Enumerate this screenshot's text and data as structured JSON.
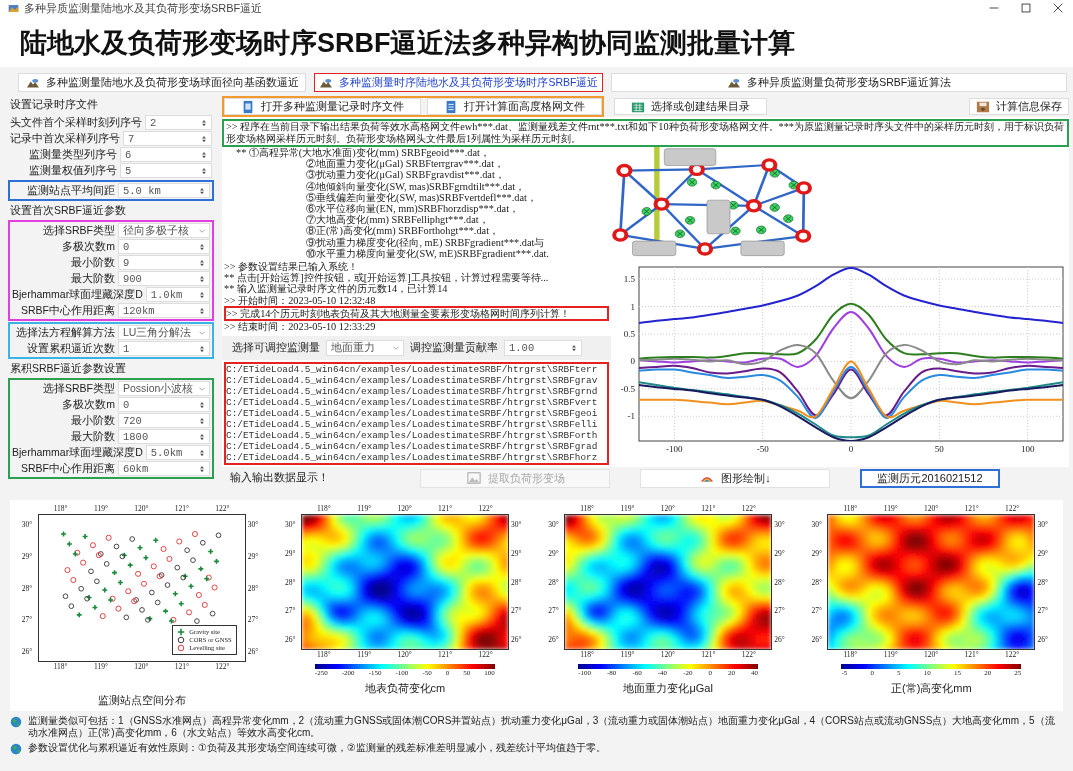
{
  "window": {
    "title": "多种异质监测量陆地水及其负荷形变场SRBF逼近"
  },
  "heading": "陆地水及负荷形变场时序SRBF逼近法多种异构协同监测批量计算",
  "tabs": [
    {
      "label": "多种监测量陆地水及负荷形变场球面径向基函数逼近",
      "selected": false
    },
    {
      "label": "多种监测量时序陆地水及其负荷形变场时序SRBF逼近",
      "selected": true
    },
    {
      "label": "多种异质监测量负荷形变场SRBF逼近算法",
      "selected": false
    }
  ],
  "settings": [
    {
      "kind": "header",
      "text": "设置记录时序文件"
    },
    {
      "kind": "group",
      "rows": [
        {
          "kind": "spin",
          "label": "头文件首个采样时刻列序号",
          "value": "2"
        },
        {
          "kind": "spin",
          "label": "记录中首次采样列序号",
          "value": "7"
        },
        {
          "kind": "spin",
          "label": "监测量类型列序号",
          "value": "6"
        },
        {
          "kind": "spin",
          "label": "监测量权值列序号",
          "value": "5"
        }
      ]
    },
    {
      "kind": "group",
      "color": "#2f6fd8",
      "rows": [
        {
          "kind": "spin",
          "label": "监测站点平均间距",
          "value": "5.0 km"
        }
      ]
    },
    {
      "kind": "header",
      "text": "设置首次SRBF逼近参数"
    },
    {
      "kind": "group",
      "color": "#e23ee0",
      "rows": [
        {
          "kind": "combo",
          "label": "选择SRBF类型",
          "value": "径向多极子核"
        },
        {
          "kind": "spin",
          "label": "多极次数m",
          "value": "0"
        },
        {
          "kind": "spin",
          "label": "最小阶数",
          "value": "9"
        },
        {
          "kind": "spin",
          "label": "最大阶数",
          "value": "900"
        },
        {
          "kind": "spin",
          "label": "Bjerhammar球面埋藏深度D",
          "value": "1.0km"
        },
        {
          "kind": "spin",
          "label": "SRBF中心作用距离",
          "value": "120km"
        }
      ]
    },
    {
      "kind": "group",
      "color": "#38b4e6",
      "rows": [
        {
          "kind": "combo",
          "label": "选择法方程解算方法",
          "value": "LU三角分解法"
        },
        {
          "kind": "spin",
          "label": "设置累积逼近次数",
          "value": "1"
        }
      ]
    },
    {
      "kind": "header",
      "text": "累积SRBF逼近参数设置"
    },
    {
      "kind": "group",
      "color": "#2aa050",
      "rows": [
        {
          "kind": "combo",
          "label": "选择SRBF类型",
          "value": "Possion小波核"
        },
        {
          "kind": "spin",
          "label": "多极次数m",
          "value": "0"
        },
        {
          "kind": "spin",
          "label": "最小阶数",
          "value": "720"
        },
        {
          "kind": "spin",
          "label": "最大阶数",
          "value": "1800"
        },
        {
          "kind": "spin",
          "label": "Bjerhammar球面埋藏深度D",
          "value": "5.0km"
        },
        {
          "kind": "spin",
          "label": "SRBF中心作用距离",
          "value": "60km"
        }
      ]
    }
  ],
  "toolbar": {
    "highlight": {
      "color": "#f29a2e",
      "buttons": [
        {
          "label": "打开多种监测量记录时序文件"
        },
        {
          "label": "打开计算面高度格网文件"
        }
      ]
    },
    "buttons": [
      {
        "label": "选择或创建结果目录"
      },
      {
        "label": "计算信息保存"
      }
    ]
  },
  "log": {
    "summary": {
      "color": "#2aa050",
      "text": ">> 程序在当前目录下输出结果负荷等效水高格网文件ewh***.dat、监测量残差文件rnt***.txt和如下10种负荷形变场格网文件。***为原监测量记录时序头文件中的采样历元时刻，用于标识负荷形变场格网采样历元时刻。负荷形变场格网头文件最后1列属性为采样历元时刻。"
    },
    "lines": [
      "**  ①高程异常(大地水准面)变化(mm) SRBFgeoid***.dat，",
      "②地面重力变化(μGal) SRBFterrgrav***.dat，",
      "③扰动重力变化(μGal) SRBFgravdist***.dat，",
      "④地倾斜向量变化(SW, mas)SRBFgrndtilt***.dat，",
      "⑤垂线偏差向量变化(SW, mas)SRBFvertdefl***.dat，",
      "⑥水平位移向量(EN, mm)SRBFhorzdisp***.dat，",
      "⑦大地高变化(mm) SRBFelliphgt***.dat，",
      "⑧正(常)高变化(mm) SRBForthohgt***.dat，",
      "⑨扰动重力梯度变化(径向, mE) SRBFgradient***.dat与",
      "⑩水平重力梯度向量变化(SW, mE)SRBFgradient***.dat."
    ]
  },
  "status": [
    {
      "text": ">> 参数设置结果已输入系统！"
    },
    {
      "text": "** 点击[开始运算]控件按钮，或[开始运算]工具按钮，计算过程需要等待..."
    },
    {
      "text": "** 输入监测量记录时序文件的历元数14，已计算14"
    },
    {
      "text": ">> 开始时间：2023-05-10 12:32:48"
    },
    {
      "text": ">> 完成14个历元时刻地表负荷及其大地测量全要素形变场格网时间序列计算！",
      "color": "#e52222"
    },
    {
      "text": ">> 结束时间：2023-05-10 12:33:29"
    }
  ],
  "adjust": {
    "label": "选择可调控监测量",
    "quantity": "地面重力",
    "ratio_label": "调控监测量贡献率",
    "ratio": "1.00"
  },
  "files": {
    "color": "#e52222",
    "lines": [
      "C:/ETideLoad4.5_win64cn/examples/LoadestimateSRBF/htrgrst\\SRBFterr",
      "C:/ETideLoad4.5_win64cn/examples/LoadestimateSRBF/htrgrst\\SRBFgrav",
      "C:/ETideLoad4.5_win64cn/examples/LoadestimateSRBF/htrgrst\\SRBFgrnd",
      "C:/ETideLoad4.5_win64cn/examples/LoadestimateSRBF/htrgrst\\SRBFvert",
      "C:/ETideLoad4.5_win64cn/examples/LoadestimateSRBF/htrgrst\\SRBFgeoi",
      "C:/ETideLoad4.5_win64cn/examples/LoadestimateSRBF/htrgrst\\SRBFelli",
      "C:/ETideLoad4.5_win64cn/examples/LoadestimateSRBF/htrgrst\\SRBForth",
      "C:/ETideLoad4.5_win64cn/examples/LoadestimateSRBF/htrgrst\\SRBFgrad",
      "C:/ETideLoad4.5_win64cn/examples/LoadestimateSRBF/htrgrst\\SRBFhorz"
    ]
  },
  "plot": {
    "chart_data": {
      "type": "line",
      "grid": true,
      "x": [
        -120,
        -110,
        -100,
        -90,
        -80,
        -70,
        -60,
        -50,
        -40,
        -30,
        -20,
        -10,
        0,
        10,
        20,
        30,
        40,
        50,
        60,
        70,
        80,
        90,
        100,
        110,
        120
      ],
      "xlim": [
        -120,
        120
      ],
      "ylim": [
        -1.45,
        1.72
      ],
      "xticks": [
        -100,
        -50,
        0,
        50,
        100
      ],
      "yticks": [
        -1,
        -0.5,
        0,
        0.5,
        1,
        1.5
      ],
      "series": [
        {
          "color": "#2323d0",
          "values": [
            0.7,
            0.74,
            0.77,
            0.8,
            0.85,
            0.9,
            0.96,
            1.02,
            1.1,
            1.2,
            1.37,
            1.58,
            1.7,
            1.58,
            1.37,
            1.2,
            1.1,
            1.02,
            0.96,
            0.9,
            0.85,
            0.8,
            0.77,
            0.74,
            0.7
          ]
        },
        {
          "color": "#2e7d1e",
          "values": [
            0.05,
            0.07,
            0.08,
            0.08,
            0.07,
            0.1,
            0.15,
            0.15,
            0.13,
            0.15,
            0.4,
            0.85,
            1.05,
            0.85,
            0.4,
            0.15,
            0.13,
            0.15,
            0.15,
            0.1,
            0.07,
            0.08,
            0.08,
            0.07,
            0.05
          ]
        },
        {
          "color": "#a040e0",
          "values": [
            0.02,
            0,
            -0.02,
            0,
            0.02,
            0,
            -0.02,
            0.05,
            0.05,
            -0.1,
            0.1,
            0.6,
            0.9,
            0.6,
            0.1,
            -0.1,
            0.05,
            0.05,
            -0.02,
            0,
            0.02,
            0,
            -0.02,
            0,
            0.02
          ]
        },
        {
          "color": "#8a8a8a",
          "values": [
            0.02,
            0.03,
            0.05,
            0.03,
            0,
            0.02,
            -0.05,
            0,
            0.2,
            0.3,
            0.15,
            -0.35,
            -0.67,
            -0.35,
            0.15,
            0.3,
            0.2,
            0,
            -0.05,
            0.02,
            0,
            0.03,
            0.05,
            0.03,
            0.02
          ]
        },
        {
          "color": "#6a1b8a",
          "values": [
            -0.12,
            -0.1,
            -0.08,
            -0.12,
            -0.2,
            -0.22,
            -0.18,
            -0.13,
            -0.2,
            -0.55,
            -0.98,
            -0.6,
            -0.15,
            -0.6,
            -0.98,
            -0.55,
            -0.2,
            -0.13,
            -0.18,
            -0.22,
            -0.2,
            -0.12,
            -0.08,
            -0.1,
            -0.12
          ]
        },
        {
          "color": "#2a8ae0",
          "values": [
            -0.17,
            -0.15,
            -0.15,
            -0.2,
            -0.25,
            -0.3,
            -0.28,
            -0.25,
            -0.35,
            -0.65,
            -1.03,
            -0.55,
            -0.1,
            -0.55,
            -1.03,
            -0.65,
            -0.35,
            -0.25,
            -0.28,
            -0.3,
            -0.25,
            -0.2,
            -0.15,
            -0.15,
            -0.17
          ]
        },
        {
          "color": "#f0901e",
          "values": [
            -0.7,
            -0.7,
            -0.7,
            -0.72,
            -0.75,
            -0.78,
            -0.75,
            -0.72,
            -0.8,
            -0.9,
            -1,
            -0.5,
            0,
            -0.5,
            -1,
            -0.9,
            -0.8,
            -0.72,
            -0.75,
            -0.78,
            -0.75,
            -0.72,
            -0.7,
            -0.7,
            -0.7
          ]
        },
        {
          "color": "#1e8a8a",
          "values": [
            -0.38,
            -0.43,
            -0.48,
            -0.52,
            -0.56,
            -0.6,
            -0.65,
            -0.7,
            -0.8,
            -0.95,
            -1.15,
            -1.35,
            -1.38,
            -1.35,
            -1.15,
            -0.95,
            -0.8,
            -0.7,
            -0.65,
            -0.6,
            -0.56,
            -0.52,
            -0.48,
            -0.43,
            -0.38
          ]
        },
        {
          "color": "#1a1a60",
          "values": [
            -0.43,
            -0.47,
            -0.5,
            -0.53,
            -0.58,
            -0.62,
            -0.66,
            -0.7,
            -0.82,
            -1,
            -1.2,
            -1.38,
            -1.45,
            -1.38,
            -1.2,
            -1,
            -0.82,
            -0.7,
            -0.66,
            -0.62,
            -0.58,
            -0.53,
            -0.5,
            -0.47,
            -0.43
          ]
        }
      ]
    }
  },
  "actions": [
    {
      "kind": "label",
      "text": "输入输出数据显示！"
    },
    {
      "kind": "button",
      "label": "提取负荷形变场",
      "disabled": true
    },
    {
      "kind": "button",
      "label": "图形绘制↓",
      "disabled": false
    },
    {
      "kind": "button",
      "label": "监测历元2016021512",
      "disabled": false,
      "color": "#2f6fd8"
    }
  ],
  "maps": [
    {
      "kind": "stations",
      "caption": "监测站点空间分布",
      "axes": {
        "top": [
          "118°",
          "119°",
          "120°",
          "121°",
          "122°"
        ],
        "bottom": [
          "118°",
          "119°",
          "120°",
          "121°",
          "122°"
        ],
        "left": [
          "30°",
          "29°",
          "28°",
          "27°",
          "26°"
        ],
        "right": [
          "30°",
          "29°",
          "28°",
          "27°",
          "26°"
        ]
      },
      "legend": [
        "Gravity site",
        "CORS or GNSS",
        "Levelling site"
      ]
    },
    {
      "kind": "heat",
      "caption": "地表负荷变化cm",
      "axes": {
        "top": [
          "118°",
          "119°",
          "120°",
          "121°",
          "122°"
        ],
        "bottom": [
          "118°",
          "119°",
          "120°",
          "121°",
          "122°"
        ],
        "left": [
          "30°",
          "29°",
          "28°",
          "27°",
          "26°"
        ],
        "right": [
          "30°",
          "29°",
          "28°",
          "27°",
          "26°"
        ]
      },
      "colorbar": [
        "-250",
        "-200",
        "-150",
        "-100",
        "-50",
        "0",
        "50",
        "100"
      ]
    },
    {
      "kind": "heat",
      "caption": "地面重力变化μGal",
      "axes": {
        "top": [
          "118°",
          "119°",
          "120°",
          "121°",
          "122°"
        ],
        "bottom": [
          "118°",
          "119°",
          "120°",
          "121°",
          "122°"
        ],
        "left": [
          "30°",
          "29°",
          "28°",
          "27°",
          "26°"
        ],
        "right": [
          "30°",
          "29°",
          "28°",
          "27°",
          "26°"
        ]
      },
      "colorbar": [
        "-100",
        "-80",
        "-60",
        "-40",
        "-20",
        "0",
        "20",
        "40"
      ]
    },
    {
      "kind": "heat",
      "caption": "正(常)高变化mm",
      "axes": {
        "top": [
          "118°",
          "119°",
          "120°",
          "121°",
          "122°"
        ],
        "bottom": [
          "118°",
          "119°",
          "120°",
          "121°",
          "122°"
        ],
        "left": [
          "30°",
          "29°",
          "28°",
          "27°",
          "26°"
        ],
        "right": [
          "30°",
          "29°",
          "28°",
          "27°",
          "26°"
        ]
      },
      "colorbar": [
        "-5",
        "0",
        "5",
        "10",
        "15",
        "20",
        "25"
      ]
    }
  ],
  "notes": [
    {
      "text": "监测量类似可包括：1（GNSS水准网点）高程异常变化mm，2（流动重力GNSS或固体潮CORS并置站点）扰动重力变化μGal，3（流动重力或固体潮站点）地面重力变化μGal，4（CORS站点或流动GNSS点）大地高变化mm，5（流动水准网点）正(常)高变化mm，6（水文站点）等效水高变化cm。"
    },
    {
      "text": "参数设置优化与累积逼近有效性原则：①负荷及其形变场空间连续可微，②监测量的残差标准差明显减小，残差统计平均值趋于零。"
    }
  ]
}
